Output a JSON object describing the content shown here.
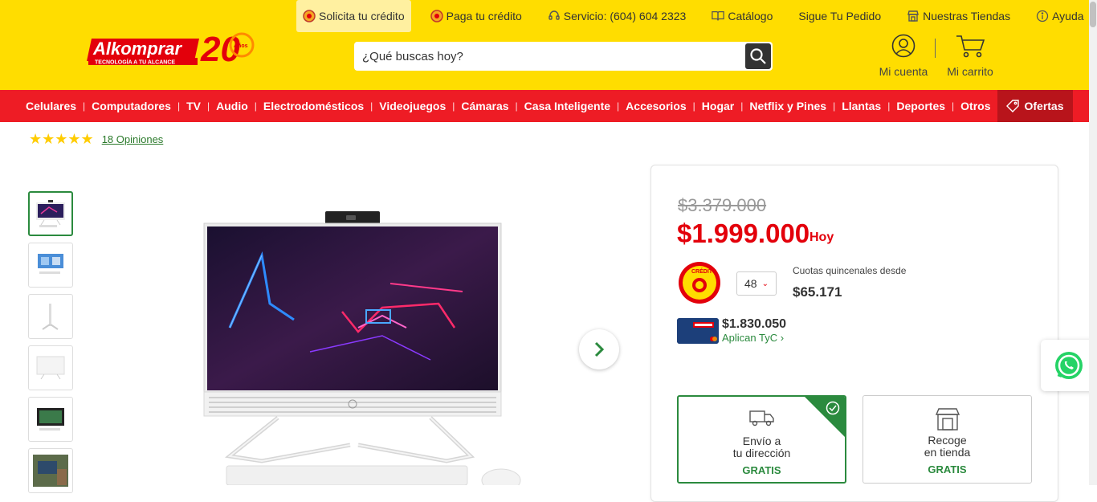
{
  "header": {
    "logo_text": "Alkomprar",
    "logo_tagline": "TECNOLOGÍA A TU ALCANCE",
    "logo_years": "20",
    "logo_years_label": "Años",
    "top_links": [
      {
        "label": "Solicita tu crédito",
        "icon": "credit-coin-icon"
      },
      {
        "label": "Paga tu crédito",
        "icon": "pay-coin-icon"
      },
      {
        "label": "Servicio: (604) 604 2323",
        "icon": "headset-icon"
      },
      {
        "label": "Catálogo",
        "icon": "catalog-icon"
      },
      {
        "label": "Sigue Tu Pedido",
        "icon": ""
      },
      {
        "label": "Nuestras Tiendas",
        "icon": "store-icon"
      },
      {
        "label": "Ayuda",
        "icon": "info-icon"
      }
    ],
    "search_placeholder": "¿Qué buscas hoy?",
    "account_label": "Mi cuenta",
    "cart_label": "Mi carrito"
  },
  "nav": {
    "items": [
      "Celulares",
      "Computadores",
      "TV",
      "Audio",
      "Electrodomésticos",
      "Videojuegos",
      "Cámaras",
      "Casa Inteligente",
      "Accesorios",
      "Hogar",
      "Netflix y Pines",
      "Llantas",
      "Deportes",
      "Otros"
    ],
    "offers_label": "Ofertas",
    "separator": "|"
  },
  "rating": {
    "stars": "★★★★★",
    "reviews_label": "18 Opiniones",
    "value": 5
  },
  "gallery": {
    "thumbnail_count": 6,
    "active_index": 0
  },
  "price": {
    "old": "$3.379.000",
    "current": "$1.999.000",
    "today_label": "Hoy",
    "credit_logo_text": "CRÉDITO",
    "installments_selected": "48",
    "installments_label": "Cuotas quincenales desde",
    "installment_value": "$65.171",
    "bank_price": "$1.830.050",
    "bank_terms": "Aplican TyC"
  },
  "delivery": [
    {
      "title": "Envío a\ntu dirección",
      "subtitle": "GRATIS",
      "selected": true
    },
    {
      "title": "Recoge\nen tienda",
      "subtitle": "GRATIS",
      "selected": false
    }
  ],
  "colors": {
    "header_yellow": "#ffdd00",
    "nav_red": "#ee1c25",
    "offers_red": "#b8141b",
    "price_red": "#e3000b",
    "green": "#2b8a3e"
  }
}
